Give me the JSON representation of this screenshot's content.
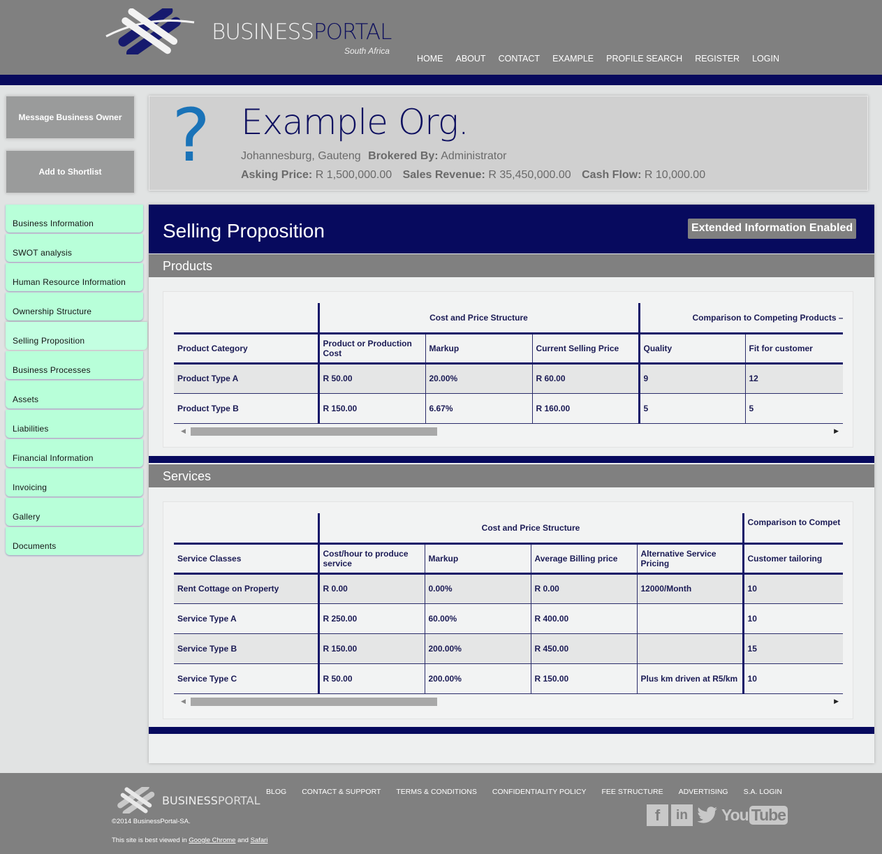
{
  "header": {
    "brand_business": "BUSINESS",
    "brand_portal": "PORTAL",
    "brand_sub": "South Africa",
    "nav": [
      "HOME",
      "ABOUT",
      "CONTACT",
      "EXAMPLE",
      "PROFILE SEARCH",
      "REGISTER",
      "LOGIN"
    ]
  },
  "actions": {
    "message_owner": "Message Business Owner",
    "add_shortlist": "Add to Shortlist"
  },
  "sidebar": {
    "items": [
      {
        "label": "Business Information"
      },
      {
        "label": "SWOT analysis"
      },
      {
        "label": "Human Resource Information"
      },
      {
        "label": "Ownership Structure"
      },
      {
        "label": "Selling Proposition",
        "active": true
      },
      {
        "label": "Business Processes"
      },
      {
        "label": "Assets"
      },
      {
        "label": "Liabilities"
      },
      {
        "label": "Financial Information"
      },
      {
        "label": "Invoicing"
      },
      {
        "label": "Gallery"
      },
      {
        "label": "Documents"
      }
    ]
  },
  "org": {
    "icon": "question-mark-icon",
    "name": "Example Org.",
    "location": "Johannesburg, Gauteng",
    "brokered_label": "Brokered By:",
    "brokered_value": "Administrator",
    "asking_label": "Asking Price:",
    "asking_value": "R 1,500,000.00",
    "revenue_label": "Sales Revenue:",
    "revenue_value": "R 35,450,000.00",
    "cashflow_label": "Cash Flow:",
    "cashflow_value": "R 10,000.00"
  },
  "section": {
    "title": "Selling Proposition",
    "badge": "Extended Information Enabled"
  },
  "products": {
    "heading": "Products",
    "group_cost": "Cost and Price Structure",
    "group_compare": "Comparison to Competing Products – I",
    "columns": [
      "Product Category",
      "Product or Production Cost",
      "Markup",
      "Current Selling Price",
      "Quality",
      "Fit for customer"
    ],
    "rows": [
      [
        "Product Type A",
        "R 50.00",
        "20.00%",
        "R 60.00",
        "9",
        "12"
      ],
      [
        "Product Type B",
        "R 150.00",
        "6.67%",
        "R 160.00",
        "5",
        "5"
      ]
    ]
  },
  "services": {
    "heading": "Services",
    "group_cost": "Cost and Price Structure",
    "group_compare": "Comparison to Compet",
    "columns": [
      "Service Classes",
      "Cost/hour to produce service",
      "Markup",
      "Average Billing price",
      "Alternative Service Pricing",
      "Customer tailoring"
    ],
    "rows": [
      [
        "Rent Cottage on Property",
        "R 0.00",
        "0.00%",
        "R 0.00",
        "12000/Month",
        "10"
      ],
      [
        "Service Type A",
        "R 250.00",
        "60.00%",
        "R 400.00",
        "",
        "10"
      ],
      [
        "Service Type B",
        "R 150.00",
        "200.00%",
        "R 450.00",
        "",
        "15"
      ],
      [
        "Service Type C",
        "R 50.00",
        "200.00%",
        "R 150.00",
        "Plus km driven at R5/km",
        "10"
      ]
    ]
  },
  "footer": {
    "brand_business": "BUSINESS",
    "brand_portal": "PORTAL",
    "nav": [
      "BLOG",
      "CONTACT & SUPPORT",
      "TERMS & CONDITIONS",
      "CONFIDENTIALITY POLICY",
      "FEE STRUCTURE",
      "ADVERTISING",
      "S.A. LOGIN"
    ],
    "copyright": "©2014 BusinessPortal-SA.",
    "best_viewed_prefix": "This site is best viewed in",
    "chrome": "Google Chrome",
    "and": "and",
    "safari": "Safari",
    "social": {
      "facebook": "f",
      "linkedin": "in",
      "youtube_you": "You",
      "youtube_tube": "Tube"
    }
  }
}
